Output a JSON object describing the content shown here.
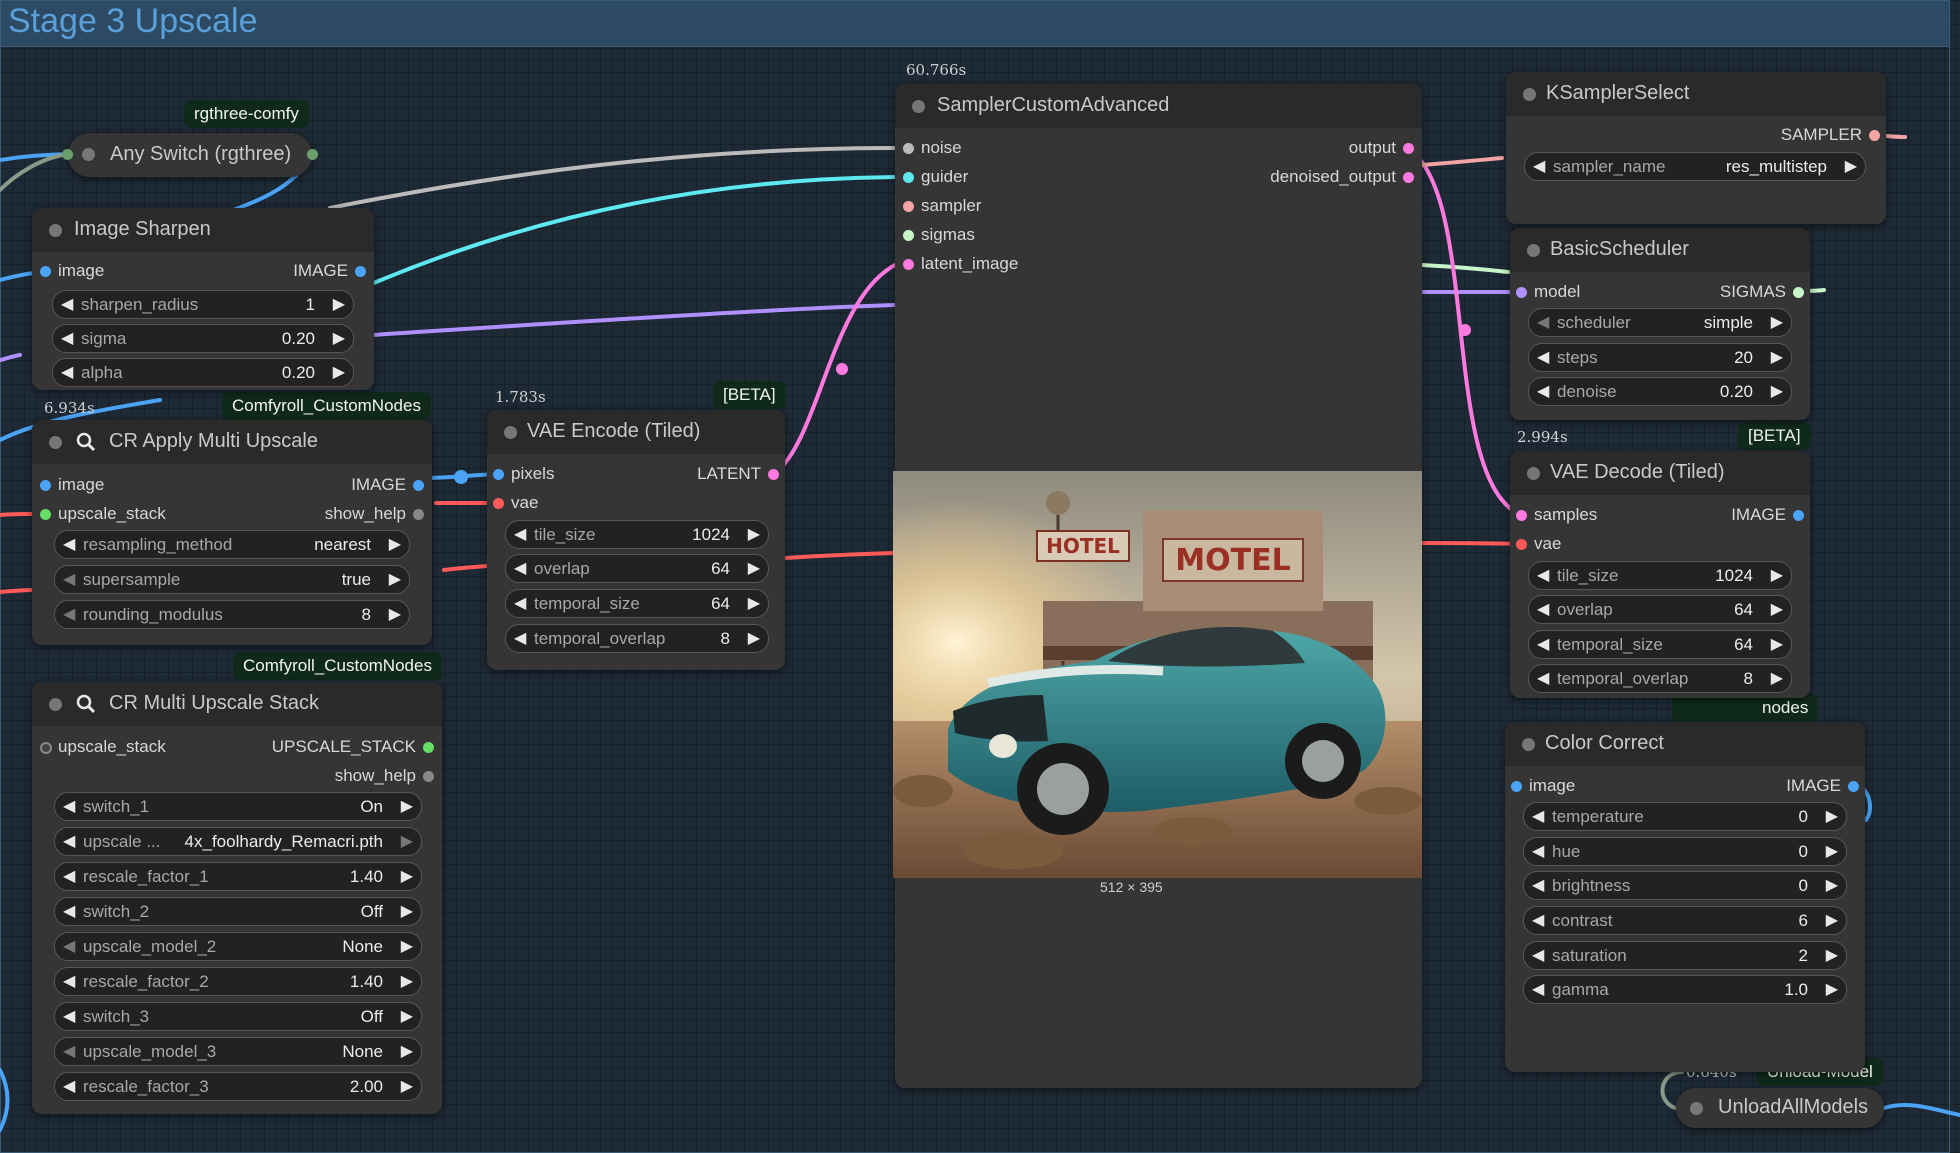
{
  "group": {
    "title": "Stage 3 Upscale"
  },
  "colors": {
    "image": "#4aa3f5",
    "latent": "#ff7ae0",
    "vae": "#ff5a5a",
    "noise": "#bbbbbb",
    "guider": "#5ee8f0",
    "sampler": "#f3a5a5",
    "sigmas": "#c8f5c8",
    "model": "#b090ff",
    "any": "#6b9e6b"
  },
  "tags": {
    "rgthree": "rgthree-comfy",
    "comfyroll_1": "Comfyroll_CustomNodes",
    "comfyroll_2": "Comfyroll_CustomNodes",
    "beta_1": "[BETA]",
    "beta_2": "[BETA]",
    "unload": "Unload-Model",
    "partial_nodes": "nodes"
  },
  "timings": {
    "sampler": "60.766s",
    "cr_apply": "6.934s",
    "vae_encode": "1.783s",
    "vae_decode": "2.994s",
    "unload": "0.640s"
  },
  "any_switch": {
    "title": "Any Switch (rgthree)"
  },
  "image_sharpen": {
    "title": "Image Sharpen",
    "in_image": "image",
    "out_image": "IMAGE",
    "widgets": [
      {
        "label": "sharpen_radius",
        "value": "1"
      },
      {
        "label": "sigma",
        "value": "0.20"
      },
      {
        "label": "alpha",
        "value": "0.20"
      }
    ]
  },
  "cr_apply": {
    "title": "CR Apply Multi Upscale",
    "in_image": "image",
    "in_stack": "upscale_stack",
    "out_image": "IMAGE",
    "out_help": "show_help",
    "widgets": [
      {
        "label": "resampling_method",
        "value": "nearest"
      },
      {
        "label": "supersample",
        "value": "true"
      },
      {
        "label": "rounding_modulus",
        "value": "8"
      }
    ]
  },
  "cr_stack": {
    "title": "CR Multi Upscale Stack",
    "in_stack": "upscale_stack",
    "out_stack": "UPSCALE_STACK",
    "out_help": "show_help",
    "widgets": [
      {
        "label": "switch_1",
        "value": "On"
      },
      {
        "label": "upscale ...",
        "value": "4x_foolhardy_Remacri.pth"
      },
      {
        "label": "rescale_factor_1",
        "value": "1.40"
      },
      {
        "label": "switch_2",
        "value": "Off"
      },
      {
        "label": "upscale_model_2",
        "value": "None"
      },
      {
        "label": "rescale_factor_2",
        "value": "1.40"
      },
      {
        "label": "switch_3",
        "value": "Off"
      },
      {
        "label": "upscale_model_3",
        "value": "None"
      },
      {
        "label": "rescale_factor_3",
        "value": "2.00"
      }
    ]
  },
  "vae_encode": {
    "title": "VAE Encode (Tiled)",
    "in_pixels": "pixels",
    "in_vae": "vae",
    "out_latent": "LATENT",
    "widgets": [
      {
        "label": "tile_size",
        "value": "1024"
      },
      {
        "label": "overlap",
        "value": "64"
      },
      {
        "label": "temporal_size",
        "value": "64"
      },
      {
        "label": "temporal_overlap",
        "value": "8"
      }
    ]
  },
  "sampler": {
    "title": "SamplerCustomAdvanced",
    "inputs": [
      "noise",
      "guider",
      "sampler",
      "sigmas",
      "latent_image"
    ],
    "out_output": "output",
    "out_denoised": "denoised_output",
    "preview_dims": "512 × 395",
    "motel_sign": "MOTEL",
    "hotel_sign": "HOTEL"
  },
  "ksampler_select": {
    "title": "KSamplerSelect",
    "out_sampler": "SAMPLER",
    "widgets": [
      {
        "label": "sampler_name",
        "value": "res_multistep"
      }
    ]
  },
  "basic_scheduler": {
    "title": "BasicScheduler",
    "in_model": "model",
    "out_sigmas": "SIGMAS",
    "widgets": [
      {
        "label": "scheduler",
        "value": "simple"
      },
      {
        "label": "steps",
        "value": "20"
      },
      {
        "label": "denoise",
        "value": "0.20"
      }
    ]
  },
  "vae_decode": {
    "title": "VAE Decode (Tiled)",
    "in_samples": "samples",
    "in_vae": "vae",
    "out_image": "IMAGE",
    "widgets": [
      {
        "label": "tile_size",
        "value": "1024"
      },
      {
        "label": "overlap",
        "value": "64"
      },
      {
        "label": "temporal_size",
        "value": "64"
      },
      {
        "label": "temporal_overlap",
        "value": "8"
      }
    ]
  },
  "color_correct": {
    "title": "Color Correct",
    "in_image": "image",
    "out_image": "IMAGE",
    "widgets": [
      {
        "label": "temperature",
        "value": "0"
      },
      {
        "label": "hue",
        "value": "0"
      },
      {
        "label": "brightness",
        "value": "0"
      },
      {
        "label": "contrast",
        "value": "6"
      },
      {
        "label": "saturation",
        "value": "2"
      },
      {
        "label": "gamma",
        "value": "1.0"
      }
    ]
  },
  "unload": {
    "title": "UnloadAllModels"
  }
}
